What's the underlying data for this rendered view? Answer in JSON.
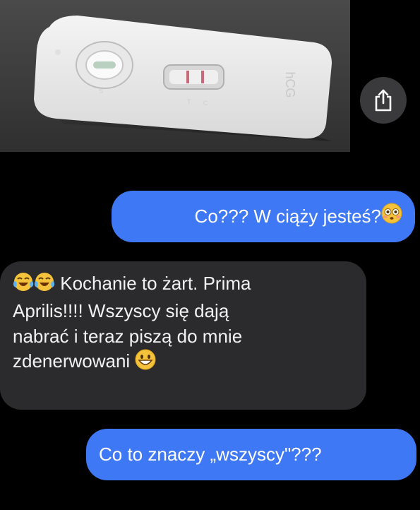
{
  "photo": {
    "test_label": "hCG",
    "test_markings": [
      "S",
      "T",
      "C"
    ]
  },
  "share": {
    "icon": "share-icon"
  },
  "messages": [
    {
      "side": "sent",
      "text": "Co??? W ciąży jesteś?",
      "trailing_emoji": "flushed-face-emoji"
    },
    {
      "side": "received",
      "leading_emoji": [
        "tears-of-joy-emoji",
        "tears-of-joy-emoji"
      ],
      "lines": [
        "Kochanie to żart. Prima",
        "Aprilis!!!! Wszyscy się dają",
        "nabrać i teraz piszą do mnie",
        "zdenerwowani"
      ],
      "trailing_emoji": "grinning-face-emoji"
    },
    {
      "side": "sent",
      "text": "Co to znaczy „wszyscy\"???"
    }
  ],
  "colors": {
    "sent_bubble": "#3f78f5",
    "received_bubble": "#2b2b2d",
    "background": "#000000"
  }
}
